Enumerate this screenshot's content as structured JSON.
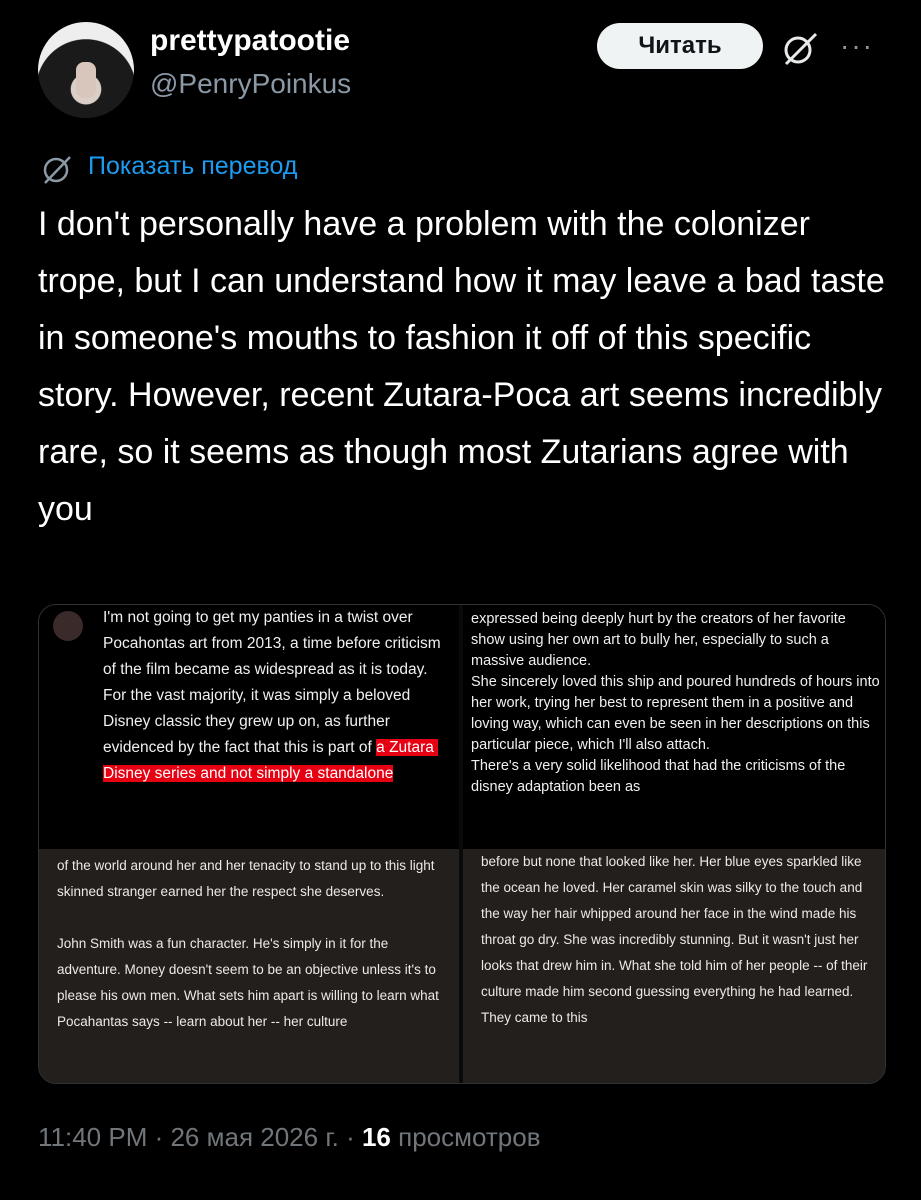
{
  "author": {
    "display_name": "prettypatootie",
    "handle": "@PenryPoinkus"
  },
  "actions": {
    "follow_label": "Читать",
    "grok_icon": "grok-icon",
    "more_icon": "more-icon"
  },
  "translate": {
    "icon": "translate-icon",
    "label": "Показать перевод"
  },
  "tweet": {
    "text": "I don't personally have a problem with the colonizer trope, but I can understand how it may leave a bad taste in someone's mouths to fashion it off of this specific story. However, recent Zutara-Poca art seems incredibly rare, so it seems as though most Zutarians agree with you"
  },
  "media": {
    "q1_text_before": "I'm not going to get my panties in a twist over Pocahontas art from 2013, a time before criticism of the film became as widespread as it is today. For the vast majority, it was simply a beloved Disney classic they grew up on, as further evidenced by the fact that this is part of ",
    "q1_highlight": "a Zutara Disney series and not simply a standalone",
    "q2_text": "expressed being deeply hurt by the creators of her favorite show using her own art to bully her, especially to such a massive audience.\nShe sincerely loved this ship and poured hundreds of hours into her work, trying her best to represent them in a positive and loving way, which can even be seen in her descriptions on this particular piece, which I'll also attach.\nThere's a very solid likelihood that had the criticisms of the disney adaptation been as",
    "q3_text": "of the world around her and her tenacity to stand up to this light skinned stranger earned her the respect she deserves.\n\nJohn Smith was a fun character. He's simply in it for the adventure. Money doesn't seem to be an objective unless it's to please his own men. What sets him apart is willing to learn what Pocahantas says -- learn about her -- her culture",
    "q4_text": "before but none that looked like her. Her blue eyes sparkled like the ocean he loved. Her caramel skin was silky to the touch and the way her hair whipped around her face in the wind made his throat go dry. She was incredibly stunning. But it wasn't just her looks that drew him in. What she told him of her people -- of their culture made him second guessing everything he had learned. They came to this"
  },
  "footer": {
    "time": "11:40 PM",
    "sep1": " · ",
    "date": "26 мая 2026 г.",
    "sep2": " · ",
    "views": "16",
    "views_label": " просмотров"
  }
}
